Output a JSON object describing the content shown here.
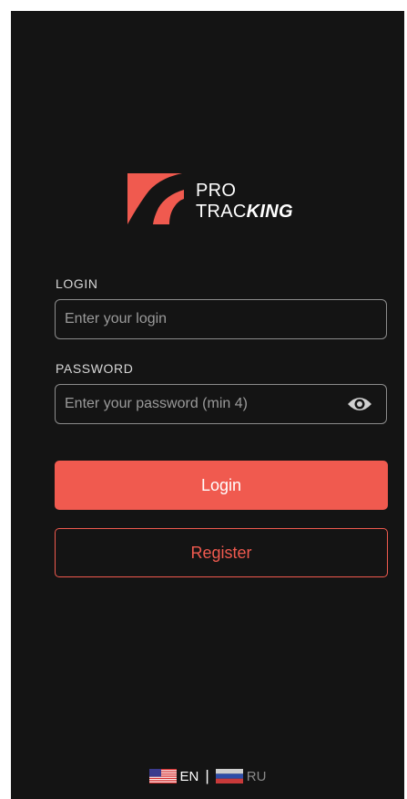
{
  "brand": {
    "line1": "PRO",
    "line2_regular": "TRAC",
    "line2_bold": "KING",
    "accent_color": "#f05a4f",
    "background_color": "#141414"
  },
  "login_form": {
    "login_label": "LOGIN",
    "login_placeholder": "Enter your login",
    "login_value": "",
    "password_label": "PASSWORD",
    "password_placeholder": "Enter your password (min 4)",
    "password_value": "",
    "password_toggle_icon": "eye-icon"
  },
  "actions": {
    "login_label": "Login",
    "register_label": "Register"
  },
  "language": {
    "options": [
      {
        "code": "EN",
        "flag": "us-flag-icon",
        "selected": true
      },
      {
        "code": "RU",
        "flag": "ru-flag-icon",
        "selected": false
      }
    ],
    "separator": "|"
  }
}
